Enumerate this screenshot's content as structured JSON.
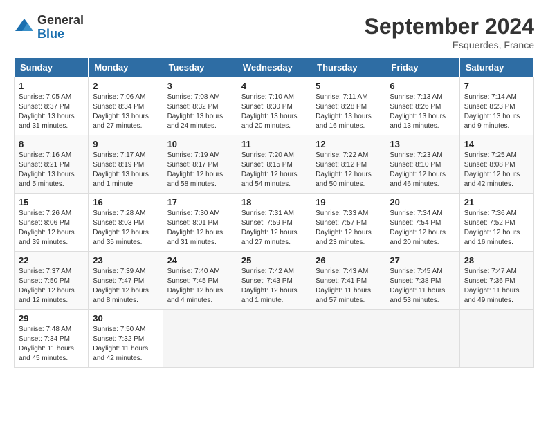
{
  "header": {
    "logo_general": "General",
    "logo_blue": "Blue",
    "title": "September 2024",
    "location": "Esquerdes, France"
  },
  "weekdays": [
    "Sunday",
    "Monday",
    "Tuesday",
    "Wednesday",
    "Thursday",
    "Friday",
    "Saturday"
  ],
  "weeks": [
    [
      {
        "day": "1",
        "info": "Sunrise: 7:05 AM\nSunset: 8:37 PM\nDaylight: 13 hours\nand 31 minutes."
      },
      {
        "day": "2",
        "info": "Sunrise: 7:06 AM\nSunset: 8:34 PM\nDaylight: 13 hours\nand 27 minutes."
      },
      {
        "day": "3",
        "info": "Sunrise: 7:08 AM\nSunset: 8:32 PM\nDaylight: 13 hours\nand 24 minutes."
      },
      {
        "day": "4",
        "info": "Sunrise: 7:10 AM\nSunset: 8:30 PM\nDaylight: 13 hours\nand 20 minutes."
      },
      {
        "day": "5",
        "info": "Sunrise: 7:11 AM\nSunset: 8:28 PM\nDaylight: 13 hours\nand 16 minutes."
      },
      {
        "day": "6",
        "info": "Sunrise: 7:13 AM\nSunset: 8:26 PM\nDaylight: 13 hours\nand 13 minutes."
      },
      {
        "day": "7",
        "info": "Sunrise: 7:14 AM\nSunset: 8:23 PM\nDaylight: 13 hours\nand 9 minutes."
      }
    ],
    [
      {
        "day": "8",
        "info": "Sunrise: 7:16 AM\nSunset: 8:21 PM\nDaylight: 13 hours\nand 5 minutes."
      },
      {
        "day": "9",
        "info": "Sunrise: 7:17 AM\nSunset: 8:19 PM\nDaylight: 13 hours\nand 1 minute."
      },
      {
        "day": "10",
        "info": "Sunrise: 7:19 AM\nSunset: 8:17 PM\nDaylight: 12 hours\nand 58 minutes."
      },
      {
        "day": "11",
        "info": "Sunrise: 7:20 AM\nSunset: 8:15 PM\nDaylight: 12 hours\nand 54 minutes."
      },
      {
        "day": "12",
        "info": "Sunrise: 7:22 AM\nSunset: 8:12 PM\nDaylight: 12 hours\nand 50 minutes."
      },
      {
        "day": "13",
        "info": "Sunrise: 7:23 AM\nSunset: 8:10 PM\nDaylight: 12 hours\nand 46 minutes."
      },
      {
        "day": "14",
        "info": "Sunrise: 7:25 AM\nSunset: 8:08 PM\nDaylight: 12 hours\nand 42 minutes."
      }
    ],
    [
      {
        "day": "15",
        "info": "Sunrise: 7:26 AM\nSunset: 8:06 PM\nDaylight: 12 hours\nand 39 minutes."
      },
      {
        "day": "16",
        "info": "Sunrise: 7:28 AM\nSunset: 8:03 PM\nDaylight: 12 hours\nand 35 minutes."
      },
      {
        "day": "17",
        "info": "Sunrise: 7:30 AM\nSunset: 8:01 PM\nDaylight: 12 hours\nand 31 minutes."
      },
      {
        "day": "18",
        "info": "Sunrise: 7:31 AM\nSunset: 7:59 PM\nDaylight: 12 hours\nand 27 minutes."
      },
      {
        "day": "19",
        "info": "Sunrise: 7:33 AM\nSunset: 7:57 PM\nDaylight: 12 hours\nand 23 minutes."
      },
      {
        "day": "20",
        "info": "Sunrise: 7:34 AM\nSunset: 7:54 PM\nDaylight: 12 hours\nand 20 minutes."
      },
      {
        "day": "21",
        "info": "Sunrise: 7:36 AM\nSunset: 7:52 PM\nDaylight: 12 hours\nand 16 minutes."
      }
    ],
    [
      {
        "day": "22",
        "info": "Sunrise: 7:37 AM\nSunset: 7:50 PM\nDaylight: 12 hours\nand 12 minutes."
      },
      {
        "day": "23",
        "info": "Sunrise: 7:39 AM\nSunset: 7:47 PM\nDaylight: 12 hours\nand 8 minutes."
      },
      {
        "day": "24",
        "info": "Sunrise: 7:40 AM\nSunset: 7:45 PM\nDaylight: 12 hours\nand 4 minutes."
      },
      {
        "day": "25",
        "info": "Sunrise: 7:42 AM\nSunset: 7:43 PM\nDaylight: 12 hours\nand 1 minute."
      },
      {
        "day": "26",
        "info": "Sunrise: 7:43 AM\nSunset: 7:41 PM\nDaylight: 11 hours\nand 57 minutes."
      },
      {
        "day": "27",
        "info": "Sunrise: 7:45 AM\nSunset: 7:38 PM\nDaylight: 11 hours\nand 53 minutes."
      },
      {
        "day": "28",
        "info": "Sunrise: 7:47 AM\nSunset: 7:36 PM\nDaylight: 11 hours\nand 49 minutes."
      }
    ],
    [
      {
        "day": "29",
        "info": "Sunrise: 7:48 AM\nSunset: 7:34 PM\nDaylight: 11 hours\nand 45 minutes."
      },
      {
        "day": "30",
        "info": "Sunrise: 7:50 AM\nSunset: 7:32 PM\nDaylight: 11 hours\nand 42 minutes."
      },
      {
        "day": "",
        "info": ""
      },
      {
        "day": "",
        "info": ""
      },
      {
        "day": "",
        "info": ""
      },
      {
        "day": "",
        "info": ""
      },
      {
        "day": "",
        "info": ""
      }
    ]
  ]
}
